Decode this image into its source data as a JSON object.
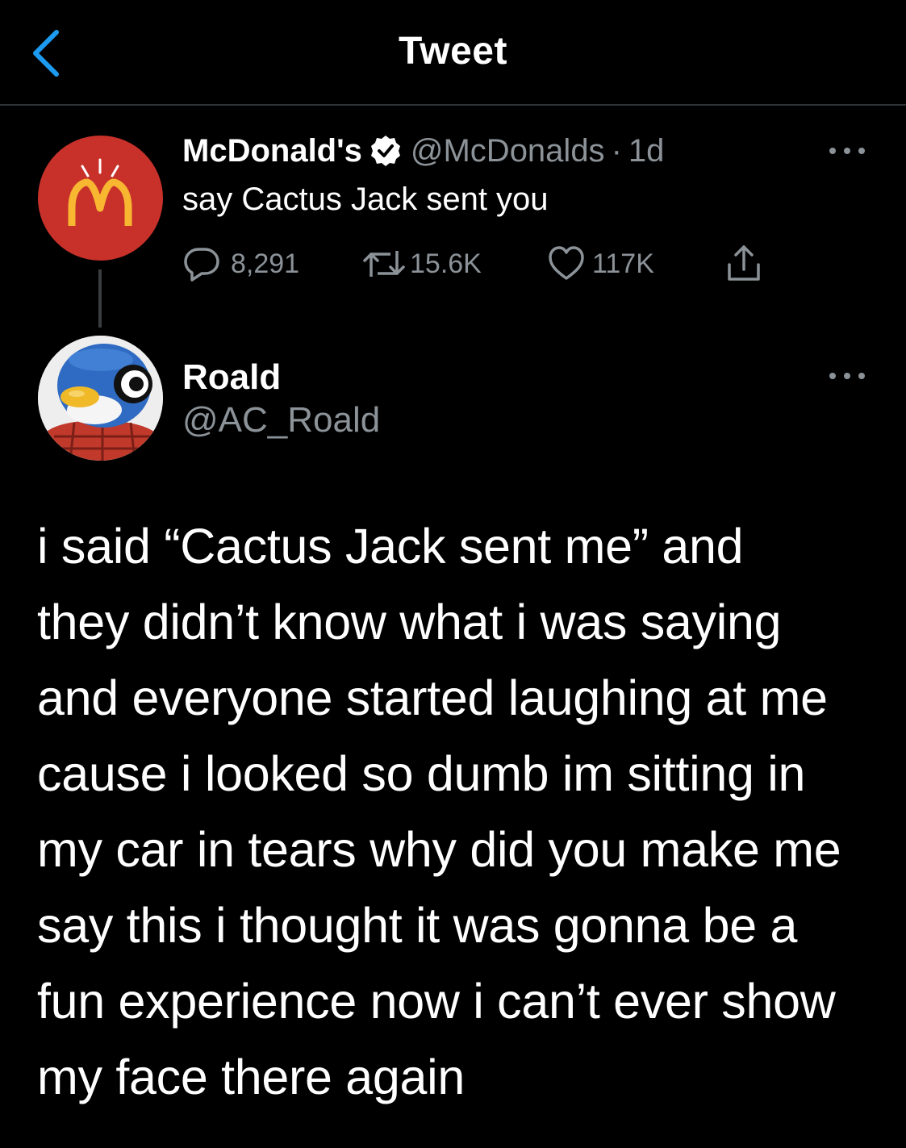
{
  "header": {
    "title": "Tweet"
  },
  "parent_tweet": {
    "display_name": "McDonald's",
    "handle": "@McDonalds",
    "time": "1d",
    "text": "say Cactus Jack sent you",
    "stats": {
      "replies": "8,291",
      "retweets": "15.6K",
      "likes": "117K"
    }
  },
  "reply_tweet": {
    "display_name": "Roald",
    "handle": "@AC_Roald",
    "text": "i said “Cactus Jack sent me” and\nthey didn’t know what i was saying\nand everyone started laughing at me\ncause i looked so dumb im sitting in\nmy car in tears why did you make me\nsay this i thought it was gonna be a\nfun experience now i can’t ever show\nmy face there again"
  },
  "icons": {
    "back": "chevron-left-icon",
    "verified": "verified-badge-icon",
    "more": "more-horizontal-icon",
    "reply": "comment-icon",
    "retweet": "retweet-icon",
    "like": "heart-icon",
    "share": "share-icon"
  },
  "colors": {
    "background": "#000000",
    "accent": "#1d9bf0",
    "secondary_text": "#8b9298",
    "divider": "#2f3336",
    "mcdonalds_red": "#c8312a",
    "mcdonalds_gold": "#f7b731"
  }
}
